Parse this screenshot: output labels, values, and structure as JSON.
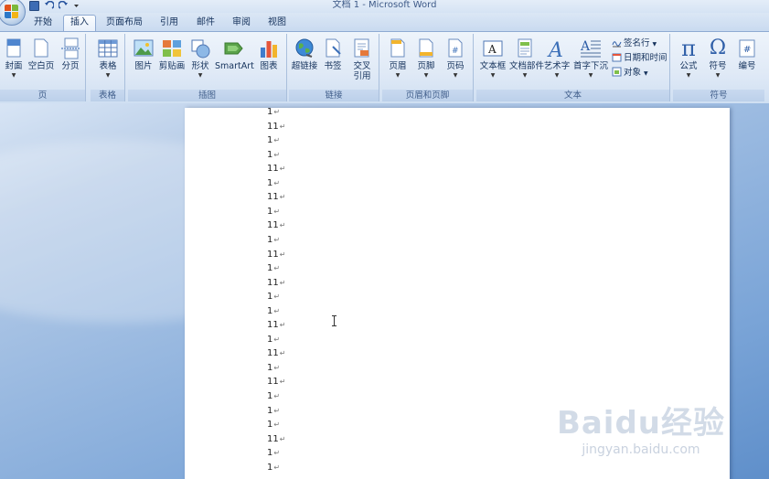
{
  "window": {
    "title": "文档 1 - Microsoft Word"
  },
  "tabs": [
    {
      "label": "开始",
      "active": false
    },
    {
      "label": "插入",
      "active": true
    },
    {
      "label": "页面布局",
      "active": false
    },
    {
      "label": "引用",
      "active": false
    },
    {
      "label": "邮件",
      "active": false
    },
    {
      "label": "审阅",
      "active": false
    },
    {
      "label": "视图",
      "active": false
    }
  ],
  "ribbon": {
    "groups": {
      "pages": {
        "label": "页",
        "buttons": [
          "封面",
          "空白页",
          "分页"
        ]
      },
      "tables": {
        "label": "表格",
        "buttons": [
          "表格"
        ]
      },
      "illustrations": {
        "label": "插图",
        "buttons": [
          "图片",
          "剪贴画",
          "形状",
          "SmartArt",
          "图表"
        ]
      },
      "links": {
        "label": "链接",
        "buttons": [
          "超链接",
          "书签",
          "交叉引用"
        ]
      },
      "header_footer": {
        "label": "页眉和页脚",
        "buttons": [
          "页眉",
          "页脚",
          "页码"
        ]
      },
      "text": {
        "label": "文本",
        "buttons": [
          "文本框",
          "文档部件",
          "艺术字",
          "首字下沉"
        ],
        "small": [
          "签名行",
          "日期和时间",
          "对象"
        ]
      },
      "symbols": {
        "label": "符号",
        "buttons": [
          "公式",
          "符号",
          "编号"
        ]
      }
    }
  },
  "document": {
    "lines": [
      "1",
      "11",
      "1",
      "1",
      "11",
      "1",
      "11",
      "1",
      "11",
      "1",
      "11",
      "1",
      "11",
      "1",
      "1",
      "11",
      "1",
      "11",
      "1",
      "11",
      "1",
      "1",
      "1",
      "11",
      "1",
      "1"
    ]
  },
  "watermark": {
    "main": "Baidu经验",
    "sub": "jingyan.baidu.com"
  },
  "colors": {
    "ribbon_bg": "#dfe9f6",
    "accent": "#15325c",
    "workspace": "#7aa4d7"
  }
}
